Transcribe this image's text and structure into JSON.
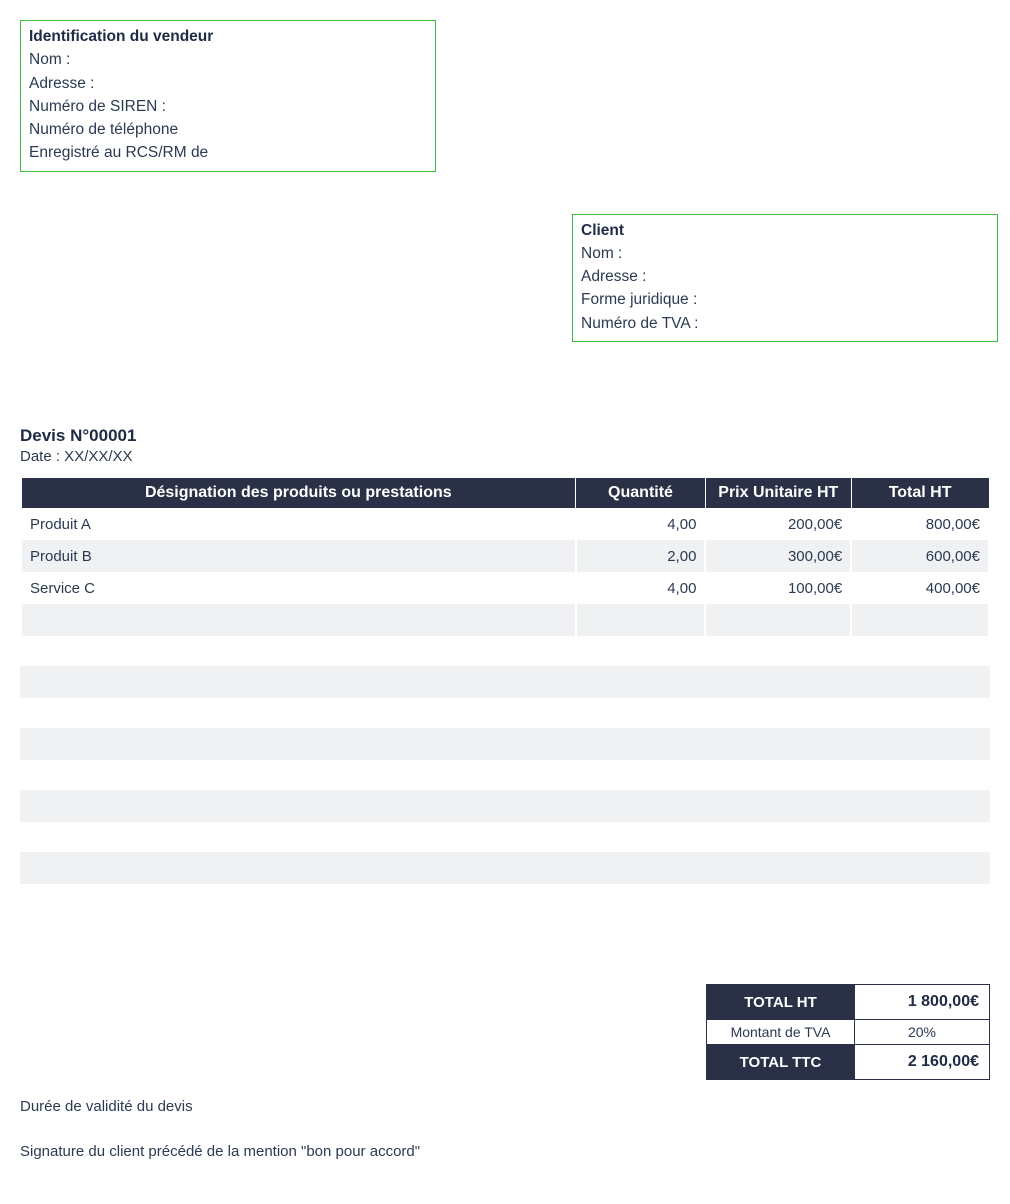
{
  "vendor": {
    "title": "Identification du vendeur",
    "name_label": "Nom :",
    "address_label": "Adresse :",
    "siren_label": "Numéro de SIREN :",
    "phone_label": "Numéro de téléphone",
    "rcs_label": "Enregistré au RCS/RM de"
  },
  "client": {
    "title": "Client",
    "name_label": "Nom :",
    "address_label": "Adresse :",
    "legal_form_label": "Forme juridique :",
    "vat_label": "Numéro de TVA :"
  },
  "quote": {
    "number_label": "Devis N°00001",
    "date_label": "Date : XX/XX/XX"
  },
  "table": {
    "headers": {
      "description": "Désignation des produits ou prestations",
      "quantity": "Quantité",
      "unit_price": "Prix Unitaire HT",
      "total": "Total HT"
    },
    "rows": [
      {
        "desc": "Produit A",
        "qty": "4,00",
        "unit": "200,00€",
        "total": "800,00€"
      },
      {
        "desc": "Produit B",
        "qty": "2,00",
        "unit": "300,00€",
        "total": "600,00€"
      },
      {
        "desc": "Service C",
        "qty": "4,00",
        "unit": "100,00€",
        "total": "400,00€"
      },
      {
        "desc": "",
        "qty": "",
        "unit": "",
        "total": ""
      }
    ]
  },
  "totals": {
    "total_ht_label": "TOTAL HT",
    "total_ht_value": "1 800,00€",
    "vat_label": "Montant de TVA",
    "vat_value": "20%",
    "total_ttc_label": "TOTAL TTC",
    "total_ttc_value": "2 160,00€"
  },
  "footer": {
    "validity": "Durée de validité du devis",
    "signature": "Signature du client précédé de la mention \"bon pour accord\""
  }
}
